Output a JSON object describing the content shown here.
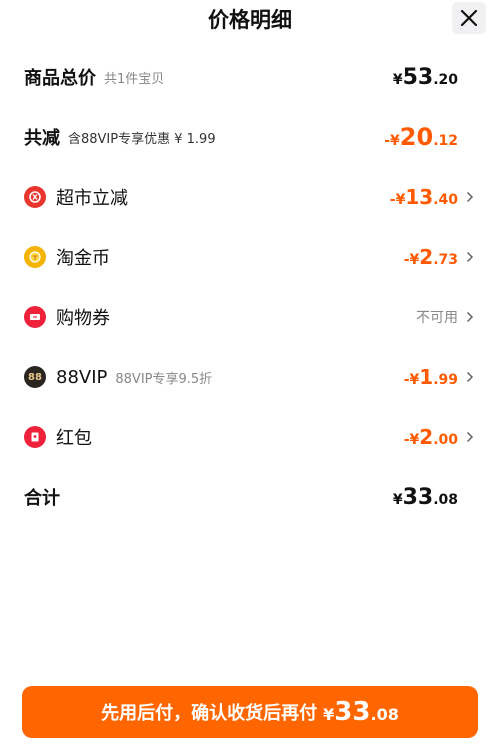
{
  "header": {
    "title": "价格明细"
  },
  "total_goods": {
    "label": "商品总价",
    "sub": "共1件宝贝",
    "yen": "¥",
    "int": "53",
    "dec": ".20"
  },
  "total_discount": {
    "label": "共减",
    "sub": "含88VIP专享优惠 ¥ 1.99",
    "sign": "-¥",
    "int": "20",
    "dec": ".12"
  },
  "items": [
    {
      "label": "超市立减",
      "sign": "-¥",
      "int": "13",
      "dec": ".40",
      "icon": "supermarket-discount-icon",
      "color": "#e8352e"
    },
    {
      "label": "淘金币",
      "sign": "-¥",
      "int": "2",
      "dec": ".73",
      "icon": "gold-coin-icon",
      "color": "#f5b400"
    },
    {
      "label": "购物券",
      "status": "不可用",
      "icon": "coupon-icon",
      "color": "#f0213a"
    },
    {
      "label": "88VIP",
      "sub": "88VIP专享9.5折",
      "sign": "-¥",
      "int": "1",
      "dec": ".99",
      "icon": "vip-88-icon",
      "icon_text": "88",
      "color": "#2b2522"
    },
    {
      "label": "红包",
      "sign": "-¥",
      "int": "2",
      "dec": ".00",
      "icon": "red-packet-icon",
      "color": "#f0213a"
    }
  ],
  "sum": {
    "label": "合计",
    "yen": "¥",
    "int": "33",
    "dec": ".08"
  },
  "pay_button": {
    "text": "先用后付，确认收货后再付",
    "yen": "¥",
    "int": "33",
    "dec": ".08"
  },
  "colors": {
    "accent": "#ff6600",
    "discount": "#ff5a00"
  }
}
